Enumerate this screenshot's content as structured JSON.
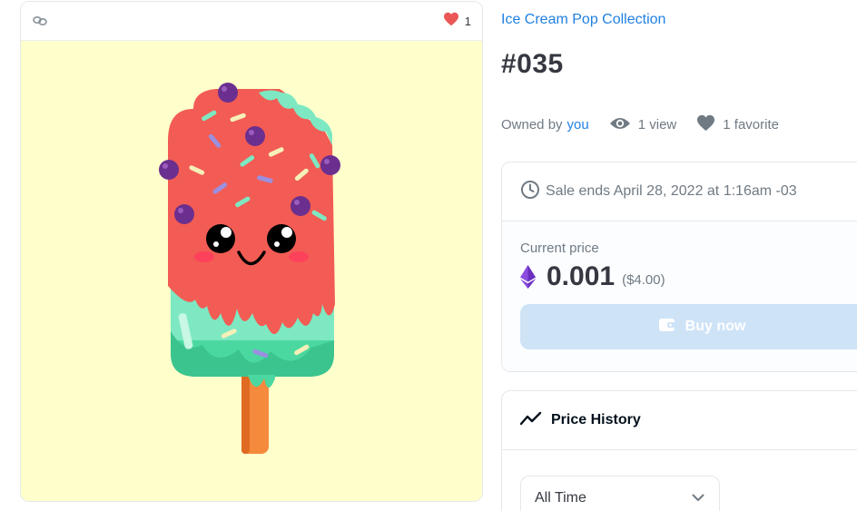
{
  "image_card": {
    "chain_icon": "link-chain-icon",
    "favorite_icon": "heart-icon",
    "favorite_count": "1",
    "background_color": "#ffffcc"
  },
  "item": {
    "collection_name": "Ice Cream Pop Collection",
    "title": "#035",
    "owned_by_label": "Owned by",
    "owner": "you",
    "views_label": "1 view",
    "favorites_label": "1 favorite"
  },
  "sale": {
    "ends_label": "Sale ends April 28, 2022 at 1:16am -03",
    "current_price_label": "Current price",
    "price": "0.001",
    "price_usd": "($4.00)",
    "currency_icon": "ethereum-icon",
    "buy_button_label": "Buy now",
    "buy_button_icon": "wallet-icon"
  },
  "price_history": {
    "title": "Price History",
    "icon": "trending-line-icon",
    "range_select_value": "All Time"
  },
  "colors": {
    "accent": "#2081e2",
    "buy_button": "#cfe3f7",
    "text": "#353840",
    "muted": "#707a83"
  }
}
